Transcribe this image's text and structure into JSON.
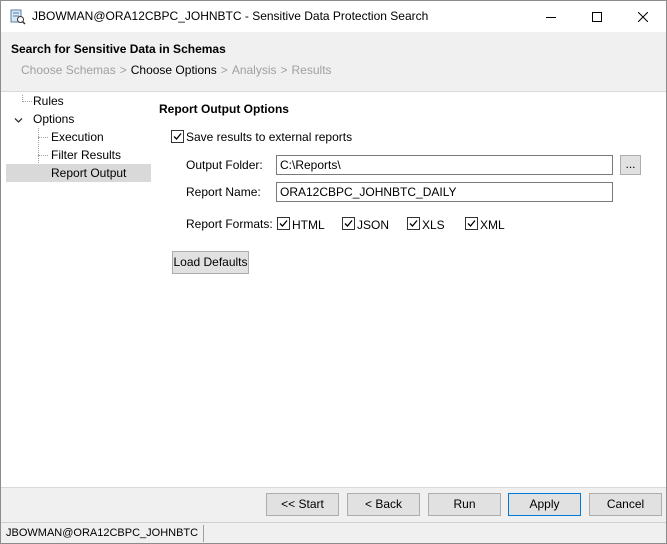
{
  "window": {
    "title": "JBOWMAN@ORA12CBPC_JOHNBTC - Sensitive Data Protection Search",
    "icon": "database-search-icon",
    "controls": [
      "minimize-icon",
      "maximize-icon",
      "close-icon"
    ]
  },
  "header": {
    "title": "Search for Sensitive Data in Schemas",
    "steps": [
      "Choose Schemas",
      "Choose Options",
      "Analysis",
      "Results"
    ],
    "separator": ">",
    "current_step": "Choose Options"
  },
  "tree": {
    "items": [
      {
        "label": "Rules"
      },
      {
        "label": "Options",
        "expanded": true
      },
      {
        "label": "Execution"
      },
      {
        "label": "Filter Results"
      },
      {
        "label": "Report Output",
        "selected": true
      }
    ]
  },
  "report": {
    "section_title": "Report Output Options",
    "save_label": "Save results to external reports",
    "save_checked": true,
    "output_folder_label": "Output Folder:",
    "output_folder_value": "C:\\Reports\\",
    "browse_label": "...",
    "report_name_label": "Report Name:",
    "report_name_value": "ORA12CBPC_JOHNBTC_DAILY",
    "formats_label": "Report Formats:",
    "formats": [
      {
        "label": "HTML",
        "checked": true
      },
      {
        "label": "JSON",
        "checked": true
      },
      {
        "label": "XLS",
        "checked": true
      },
      {
        "label": "XML",
        "checked": true
      }
    ],
    "load_defaults_label": "Load Defaults"
  },
  "footer": {
    "start_label": "<< Start",
    "back_label": "< Back",
    "run_label": "Run",
    "apply_label": "Apply",
    "cancel_label": "Cancel"
  },
  "status": {
    "connection": "JBOWMAN@ORA12CBPC_JOHNBTC"
  },
  "colors": {
    "title_bg": "#ffffff",
    "chrome_bg": "#f0f0f0",
    "selected_bg": "#d9d9d9",
    "primary_border": "#0078d7",
    "disabled_text": "#a0a0a0"
  }
}
